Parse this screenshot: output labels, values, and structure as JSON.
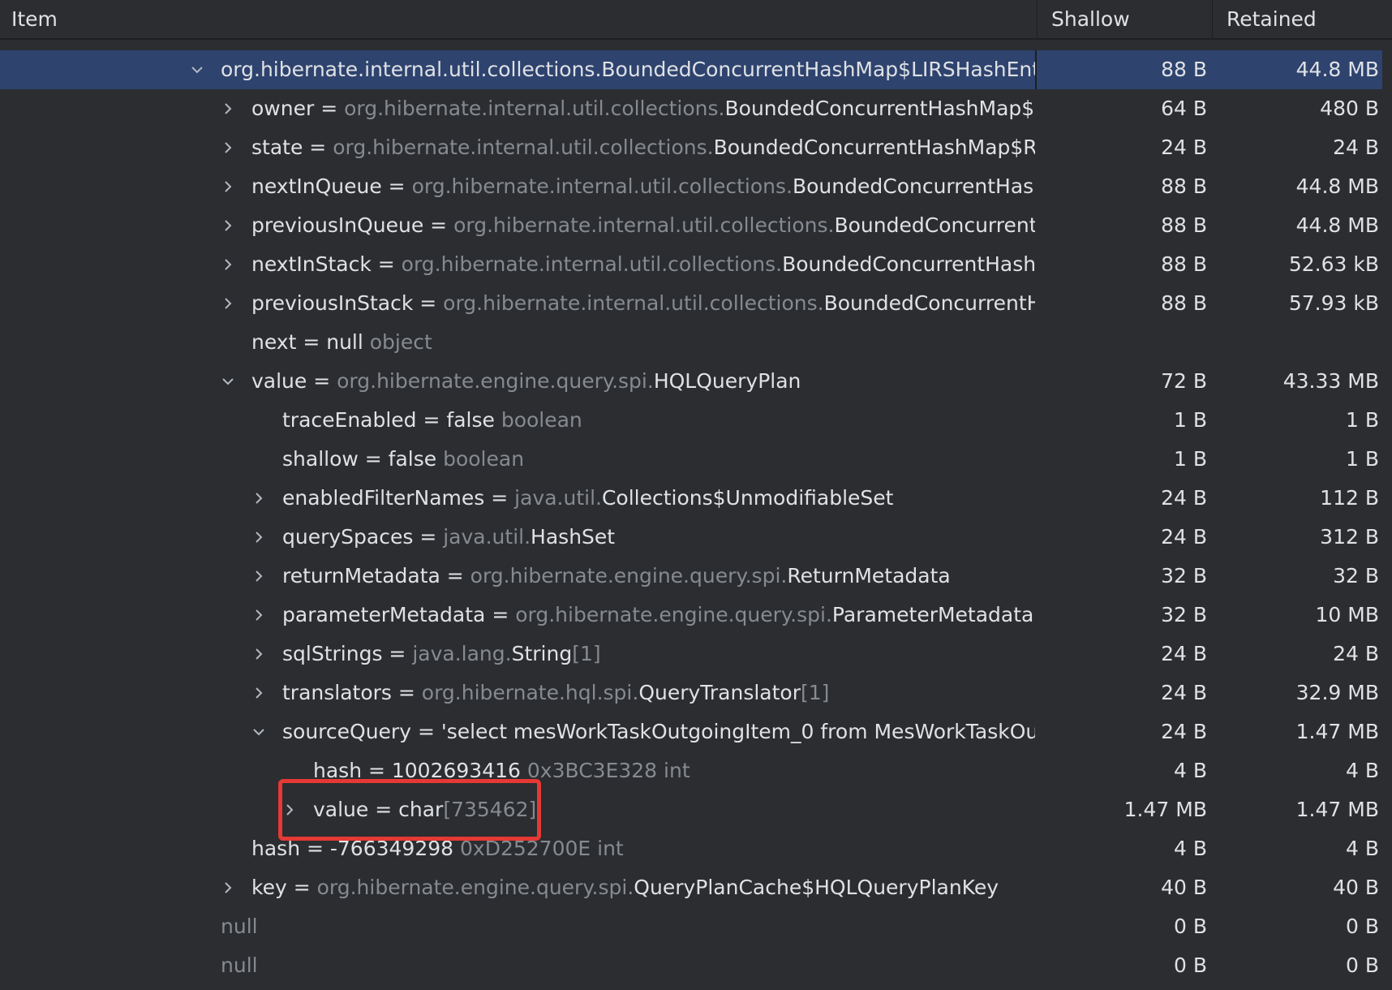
{
  "columns": {
    "item": "Item",
    "shallow": "Shallow",
    "retained": "Retained"
  },
  "rows": [
    {
      "depth": 0,
      "expander": "expanded",
      "selected": true,
      "name": "",
      "sep": "",
      "pkg": "",
      "cls": "org.hibernate.internal.util.collections.BoundedConcurrentHashMap$LIRSHashEntr",
      "suffix": "",
      "shallow": "88 B",
      "retained": "44.8 MB"
    },
    {
      "depth": 1,
      "expander": "collapsed",
      "name": "owner",
      "sep": " = ",
      "pkg": "org.hibernate.internal.util.collections.",
      "cls": "BoundedConcurrentHashMap$LI",
      "suffix": "",
      "shallow": "64 B",
      "retained": "480 B"
    },
    {
      "depth": 1,
      "expander": "collapsed",
      "name": "state",
      "sep": " = ",
      "pkg": "org.hibernate.internal.util.collections.",
      "cls": "BoundedConcurrentHashMap$Rec",
      "suffix": "",
      "shallow": "24 B",
      "retained": "24 B"
    },
    {
      "depth": 1,
      "expander": "collapsed",
      "name": "nextInQueue",
      "sep": " = ",
      "pkg": "org.hibernate.internal.util.collections.",
      "cls": "BoundedConcurrentHashM",
      "suffix": "",
      "shallow": "88 B",
      "retained": "44.8 MB"
    },
    {
      "depth": 1,
      "expander": "collapsed",
      "name": "previousInQueue",
      "sep": " = ",
      "pkg": "org.hibernate.internal.util.collections.",
      "cls": "BoundedConcurrentHa",
      "suffix": "",
      "shallow": "88 B",
      "retained": "44.8 MB"
    },
    {
      "depth": 1,
      "expander": "collapsed",
      "name": "nextInStack",
      "sep": " = ",
      "pkg": "org.hibernate.internal.util.collections.",
      "cls": "BoundedConcurrentHashM",
      "suffix": "",
      "shallow": "88 B",
      "retained": "52.63 kB"
    },
    {
      "depth": 1,
      "expander": "collapsed",
      "name": "previousInStack",
      "sep": " = ",
      "pkg": "org.hibernate.internal.util.collections.",
      "cls": "BoundedConcurrentHa",
      "suffix": "",
      "shallow": "88 B",
      "retained": "57.93 kB"
    },
    {
      "depth": 1,
      "expander": "none",
      "name": "next = null",
      "sep": "",
      "pkg": "",
      "cls": "",
      "suffix": " object",
      "shallow": "",
      "retained": ""
    },
    {
      "depth": 1,
      "expander": "expanded",
      "name": "value",
      "sep": " = ",
      "pkg": "org.hibernate.engine.query.spi.",
      "cls": "HQLQueryPlan",
      "suffix": "",
      "shallow": "72 B",
      "retained": "43.33 MB"
    },
    {
      "depth": 2,
      "expander": "none",
      "name": "traceEnabled = false",
      "sep": "",
      "pkg": "",
      "cls": "",
      "suffix": " boolean",
      "shallow": "1 B",
      "retained": "1 B"
    },
    {
      "depth": 2,
      "expander": "none",
      "name": "shallow = false",
      "sep": "",
      "pkg": "",
      "cls": "",
      "suffix": " boolean",
      "shallow": "1 B",
      "retained": "1 B"
    },
    {
      "depth": 2,
      "expander": "collapsed",
      "name": "enabledFilterNames",
      "sep": " = ",
      "pkg": "java.util.",
      "cls": "Collections$UnmodifiableSet",
      "suffix": "",
      "shallow": "24 B",
      "retained": "112 B"
    },
    {
      "depth": 2,
      "expander": "collapsed",
      "name": "querySpaces",
      "sep": " = ",
      "pkg": "java.util.",
      "cls": "HashSet",
      "suffix": "",
      "shallow": "24 B",
      "retained": "312 B"
    },
    {
      "depth": 2,
      "expander": "collapsed",
      "name": "returnMetadata",
      "sep": " = ",
      "pkg": "org.hibernate.engine.query.spi.",
      "cls": "ReturnMetadata",
      "suffix": "",
      "shallow": "32 B",
      "retained": "32 B"
    },
    {
      "depth": 2,
      "expander": "collapsed",
      "name": "parameterMetadata",
      "sep": " = ",
      "pkg": "org.hibernate.engine.query.spi.",
      "cls": "ParameterMetadata",
      "suffix": "",
      "shallow": "32 B",
      "retained": "10 MB"
    },
    {
      "depth": 2,
      "expander": "collapsed",
      "name": "sqlStrings",
      "sep": " = ",
      "pkg": "java.lang.",
      "cls": "String",
      "suffix": "[1]",
      "shallow": "24 B",
      "retained": "24 B"
    },
    {
      "depth": 2,
      "expander": "collapsed",
      "name": "translators",
      "sep": " = ",
      "pkg": "org.hibernate.hql.spi.",
      "cls": "QueryTranslator",
      "suffix": "[1]",
      "shallow": "24 B",
      "retained": "32.9 MB"
    },
    {
      "depth": 2,
      "expander": "expanded",
      "name": "sourceQuery = 'select mesWorkTaskOutgoingItem_0 from MesWorkTaskOu",
      "sep": "",
      "pkg": "",
      "cls": "",
      "suffix": "",
      "shallow": "24 B",
      "retained": "1.47 MB"
    },
    {
      "depth": 3,
      "expander": "none",
      "name": "hash = 1002693416",
      "sep": "",
      "pkg": "",
      "cls": "",
      "suffix": " 0x3BC3E328  int",
      "shallow": "4 B",
      "retained": "4 B"
    },
    {
      "depth": 3,
      "expander": "collapsed",
      "name": "value = char",
      "sep": "",
      "pkg": "",
      "cls": "",
      "suffix": "[735462]",
      "shallow": "1.47 MB",
      "retained": "1.47 MB",
      "highlighted": true
    },
    {
      "depth": 1,
      "expander": "none",
      "name": "hash = -766349298",
      "sep": "",
      "pkg": "",
      "cls": "",
      "suffix": " 0xD252700E  int",
      "shallow": "4 B",
      "retained": "4 B"
    },
    {
      "depth": 1,
      "expander": "collapsed",
      "name": "key",
      "sep": " = ",
      "pkg": "org.hibernate.engine.query.spi.",
      "cls": "QueryPlanCache$HQLQueryPlanKey",
      "suffix": "",
      "shallow": "40 B",
      "retained": "40 B"
    },
    {
      "depth": 0,
      "expander": "none",
      "name": "",
      "sep": "",
      "pkg": "",
      "cls": "",
      "suffix": "null",
      "shallow": "0 B",
      "retained": "0 B"
    },
    {
      "depth": 0,
      "expander": "none",
      "name": "",
      "sep": "",
      "pkg": "",
      "cls": "",
      "suffix": "null",
      "shallow": "0 B",
      "retained": "0 B"
    }
  ],
  "colors": {
    "background": "#2b2d30",
    "selected_row": "#2e436e",
    "dim_text": "#868a91",
    "text": "#dfe1e5",
    "highlight_border": "#e53935"
  }
}
